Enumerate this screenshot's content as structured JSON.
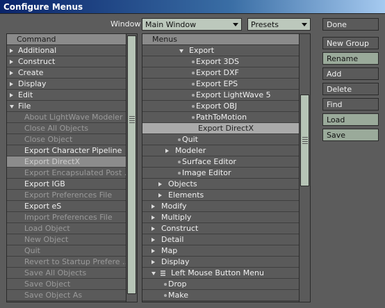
{
  "window": {
    "title": "Configure Menus"
  },
  "toolbar": {
    "window_label": "Window",
    "window_select_value": "Main Window",
    "presets_select_value": "Presets"
  },
  "command_panel": {
    "header": "Command",
    "items": [
      {
        "label": "Additional",
        "icon": "triangle-right-icon",
        "state": "normal"
      },
      {
        "label": "Construct",
        "icon": "triangle-right-icon",
        "state": "normal"
      },
      {
        "label": "Create",
        "icon": "triangle-right-icon",
        "state": "normal"
      },
      {
        "label": "Display",
        "icon": "triangle-right-icon",
        "state": "normal"
      },
      {
        "label": "Edit",
        "icon": "triangle-right-icon",
        "state": "normal"
      },
      {
        "label": "File",
        "icon": "triangle-down-icon",
        "state": "normal"
      },
      {
        "label": "About LightWave Modeler",
        "state": "dim"
      },
      {
        "label": "Close All Objects",
        "state": "dim"
      },
      {
        "label": "Close Object",
        "state": "dim"
      },
      {
        "label": "Export Character Pipeline",
        "state": "normal"
      },
      {
        "label": "Export DirectX",
        "state": "selected"
      },
      {
        "label": "Export Encapsulated Post ...",
        "state": "dim"
      },
      {
        "label": "Export IGB",
        "state": "normal"
      },
      {
        "label": "Export Preferences File",
        "state": "dim"
      },
      {
        "label": "Export eS",
        "state": "normal"
      },
      {
        "label": "Import Preferences File",
        "state": "dim"
      },
      {
        "label": "Load Object",
        "state": "dim"
      },
      {
        "label": "New Object",
        "state": "dim"
      },
      {
        "label": "Quit",
        "state": "dim"
      },
      {
        "label": "Revert to Startup Prefere ...",
        "state": "dim"
      },
      {
        "label": "Save All Objects",
        "state": "dim"
      },
      {
        "label": "Save Object",
        "state": "dim"
      },
      {
        "label": "Save Object As",
        "state": "dim"
      }
    ]
  },
  "menus_panel": {
    "header": "Menus",
    "items": [
      {
        "label": "Export",
        "icon": "triangle-down-icon",
        "depth": 4,
        "state": "normal"
      },
      {
        "label": "Export 3DS",
        "icon": "dot-icon",
        "depth": 5,
        "state": "normal"
      },
      {
        "label": "Export DXF",
        "icon": "dot-icon",
        "depth": 5,
        "state": "normal"
      },
      {
        "label": "Export EPS",
        "icon": "dot-icon",
        "depth": 5,
        "state": "normal"
      },
      {
        "label": "Export LightWave 5",
        "icon": "dot-icon",
        "depth": 5,
        "state": "normal"
      },
      {
        "label": "Export OBJ",
        "icon": "dot-icon",
        "depth": 5,
        "state": "normal"
      },
      {
        "label": "PathToMotion",
        "icon": "dot-icon",
        "depth": 5,
        "state": "normal"
      },
      {
        "label": "Export DirectX",
        "icon": "none",
        "depth": 5,
        "state": "selected"
      },
      {
        "label": "Quit",
        "icon": "dot-icon",
        "depth": 3,
        "state": "normal"
      },
      {
        "label": "Modeler",
        "icon": "triangle-right-icon",
        "depth": 2,
        "state": "normal"
      },
      {
        "label": "Surface Editor",
        "icon": "dot-icon",
        "depth": 3,
        "state": "normal"
      },
      {
        "label": "Image Editor",
        "icon": "dot-icon",
        "depth": 3,
        "state": "normal"
      },
      {
        "label": "Objects",
        "icon": "triangle-right-icon",
        "depth": 1,
        "state": "normal"
      },
      {
        "label": "Elements",
        "icon": "triangle-right-icon",
        "depth": 1,
        "state": "normal"
      },
      {
        "label": "Modify",
        "icon": "triangle-right-icon",
        "depth": 0,
        "state": "normal"
      },
      {
        "label": "Multiply",
        "icon": "triangle-right-icon",
        "depth": 0,
        "state": "normal"
      },
      {
        "label": "Construct",
        "icon": "triangle-right-icon",
        "depth": 0,
        "state": "normal"
      },
      {
        "label": "Detail",
        "icon": "triangle-right-icon",
        "depth": 0,
        "state": "normal"
      },
      {
        "label": "Map",
        "icon": "triangle-right-icon",
        "depth": 0,
        "state": "normal"
      },
      {
        "label": "Display",
        "icon": "triangle-right-icon",
        "depth": 0,
        "state": "normal"
      },
      {
        "label": "Left Mouse Button Menu",
        "icon": "triangle-down-icon",
        "depth": 0,
        "state": "normal",
        "extra_icon": "menu-lines-icon"
      },
      {
        "label": "Drop",
        "icon": "dot-icon",
        "depth": 1,
        "state": "normal"
      },
      {
        "label": "Make",
        "icon": "dot-icon",
        "depth": 1,
        "state": "normal"
      }
    ]
  },
  "buttons": {
    "done": "Done",
    "new_group": "New Group",
    "rename": "Rename",
    "add": "Add",
    "delete": "Delete",
    "find": "Find",
    "load": "Load",
    "save": "Save"
  }
}
